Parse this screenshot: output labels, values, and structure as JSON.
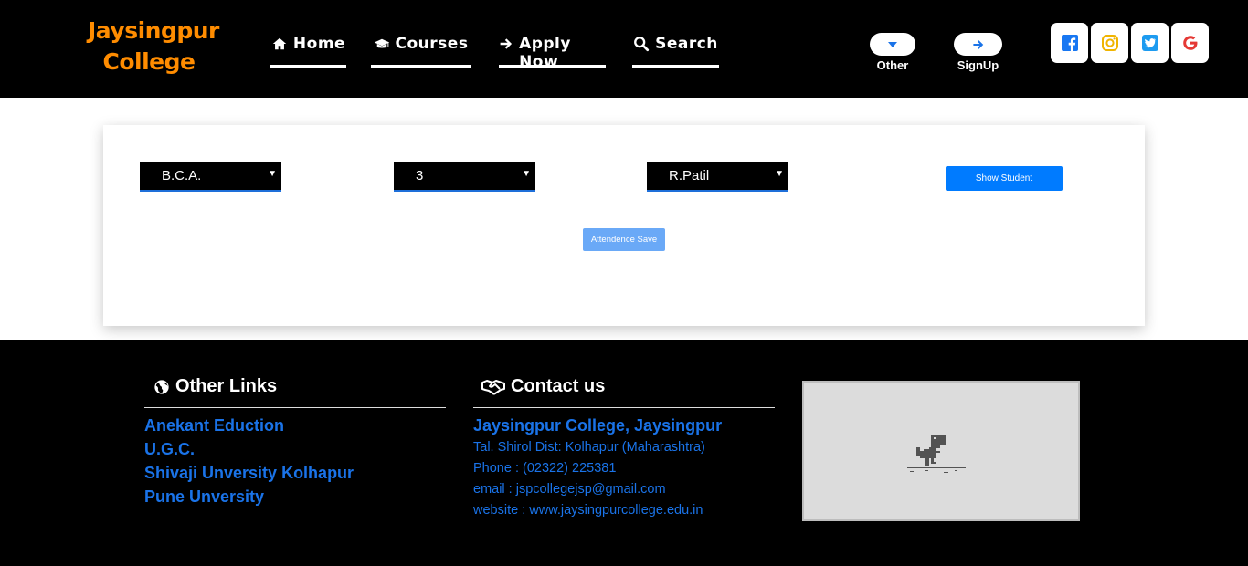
{
  "brand": {
    "line1": "Jaysingpur",
    "line2": "College"
  },
  "nav": [
    {
      "label": "Home",
      "icon": "home-icon"
    },
    {
      "label": "Courses",
      "icon": "graduation-cap-icon"
    },
    {
      "label": "Apply Now",
      "icon": "arrow-right-icon"
    },
    {
      "label": "Search",
      "icon": "search-icon"
    }
  ],
  "header_buttons": {
    "other_label": "Other",
    "signup_label": "SignUp"
  },
  "social": [
    "facebook-icon",
    "instagram-icon",
    "twitter-icon",
    "google-icon"
  ],
  "form": {
    "course": "B.C.A.",
    "semester": "3",
    "teacher": "R.Patil",
    "show_label": "Show Student",
    "save_label": "Attendence Save"
  },
  "footer": {
    "links_title": "Other Links",
    "links": [
      "Anekant Eduction",
      "U.G.C.",
      "Shivaji Unversity Kolhapur",
      "Pune Unversity"
    ],
    "contact_title": "Contact us",
    "contact_name": "Jaysingpur College, Jaysingpur",
    "contact_address": "Tal. Shirol Dist: Kolhapur (Maharashtra)",
    "contact_phone": "Phone : (02322) 225381",
    "contact_email": "email : jspcollegejsp@gmail.com",
    "contact_website": "website : www.jaysingpurcollege.edu.in"
  },
  "colors": {
    "accent": "#007bff",
    "brand": "#ff8c00",
    "link": "#1a73e8"
  }
}
